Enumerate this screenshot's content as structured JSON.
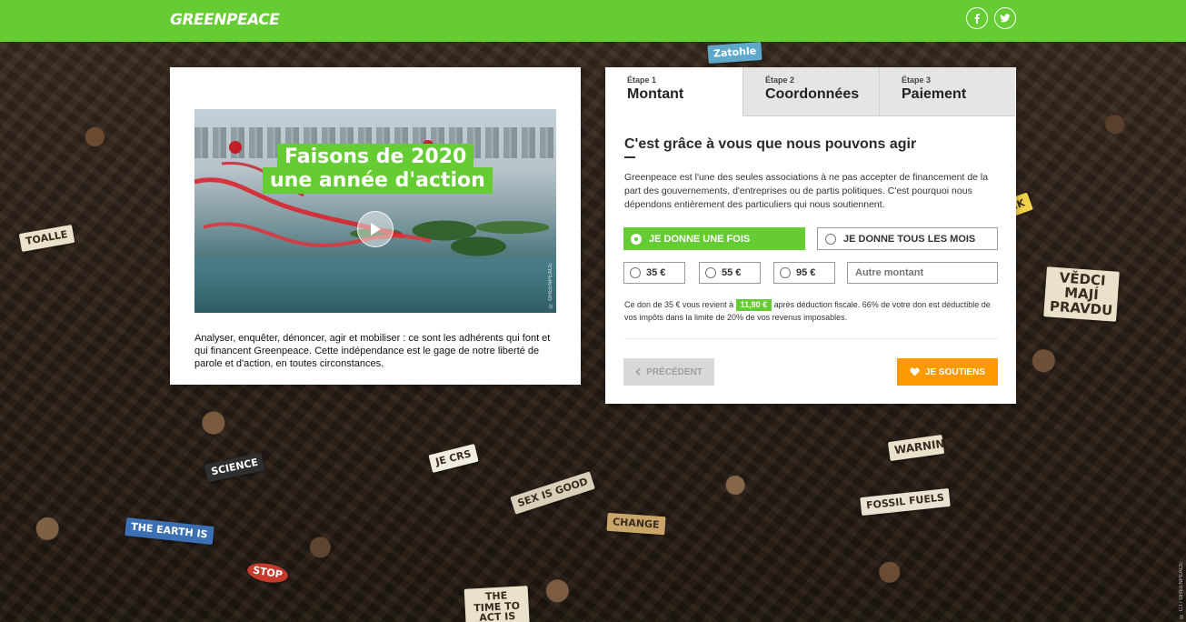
{
  "header": {
    "logo": "GREENPEACE",
    "social": [
      {
        "icon": "facebook-icon",
        "glyph": "f"
      },
      {
        "icon": "twitter-icon",
        "glyph": "twitter"
      }
    ]
  },
  "background_signs": [
    "Zatohle",
    "TOALLE",
    "VĚDCI MAJÍ PRAVDU",
    "WARNING",
    "SCIENCE",
    "JE CRS",
    "THE EARTH IS",
    "CHANGE",
    "FOSSIL FUELS",
    "SEX IS GOOD",
    "STOP",
    "THE TIME TO ACT IS NOW",
    "BLACK"
  ],
  "video": {
    "headline_line1": "Faisons de 2020",
    "headline_line2": "une année d'action",
    "watermark": "© GREENPEACE"
  },
  "left_text": "Analyser, enquêter, dénoncer, agir et mobiliser : ce sont les adhérents qui font et qui financent Greenpeace. Cette indépendance est le gage de notre liberté de parole et d'action, en toutes circonstances.",
  "steps": [
    {
      "step": "Étape 1",
      "name": "Montant",
      "active": true
    },
    {
      "step": "Étape 2",
      "name": "Coordonnées",
      "active": false
    },
    {
      "step": "Étape 3",
      "name": "Paiement",
      "active": false
    }
  ],
  "form": {
    "title": "C'est grâce à vous que nous pouvons agir",
    "description": "Greenpeace est l'une des seules associations à ne pas accepter de financement de la part des gouvernements, d'entreprises ou de partis politiques. C'est pourquoi nous dépendons entièrement des particuliers qui nous soutiennent.",
    "frequency": {
      "once": "Je donne une fois",
      "monthly": "Je donne tous les mois",
      "selected": "once"
    },
    "amounts": [
      "35 €",
      "55 €",
      "95 €"
    ],
    "other_amount_placeholder": "Autre montant",
    "tax_note_before": "Ce don de 35 € vous revient à",
    "tax_amount": "11,90 €",
    "tax_note_after": "après déduction fiscale. 66% de votre don est déductible de vos impôts dans la limite de 20% de vos revenus imposables."
  },
  "buttons": {
    "previous": "Précédent",
    "support": "Je soutiens"
  },
  "photo_credit": "© C.I / GREENPEACE",
  "colors": {
    "brand_green": "#66cc33",
    "cta_orange": "#ff9900",
    "disabled_gray": "#d8d8d8"
  }
}
